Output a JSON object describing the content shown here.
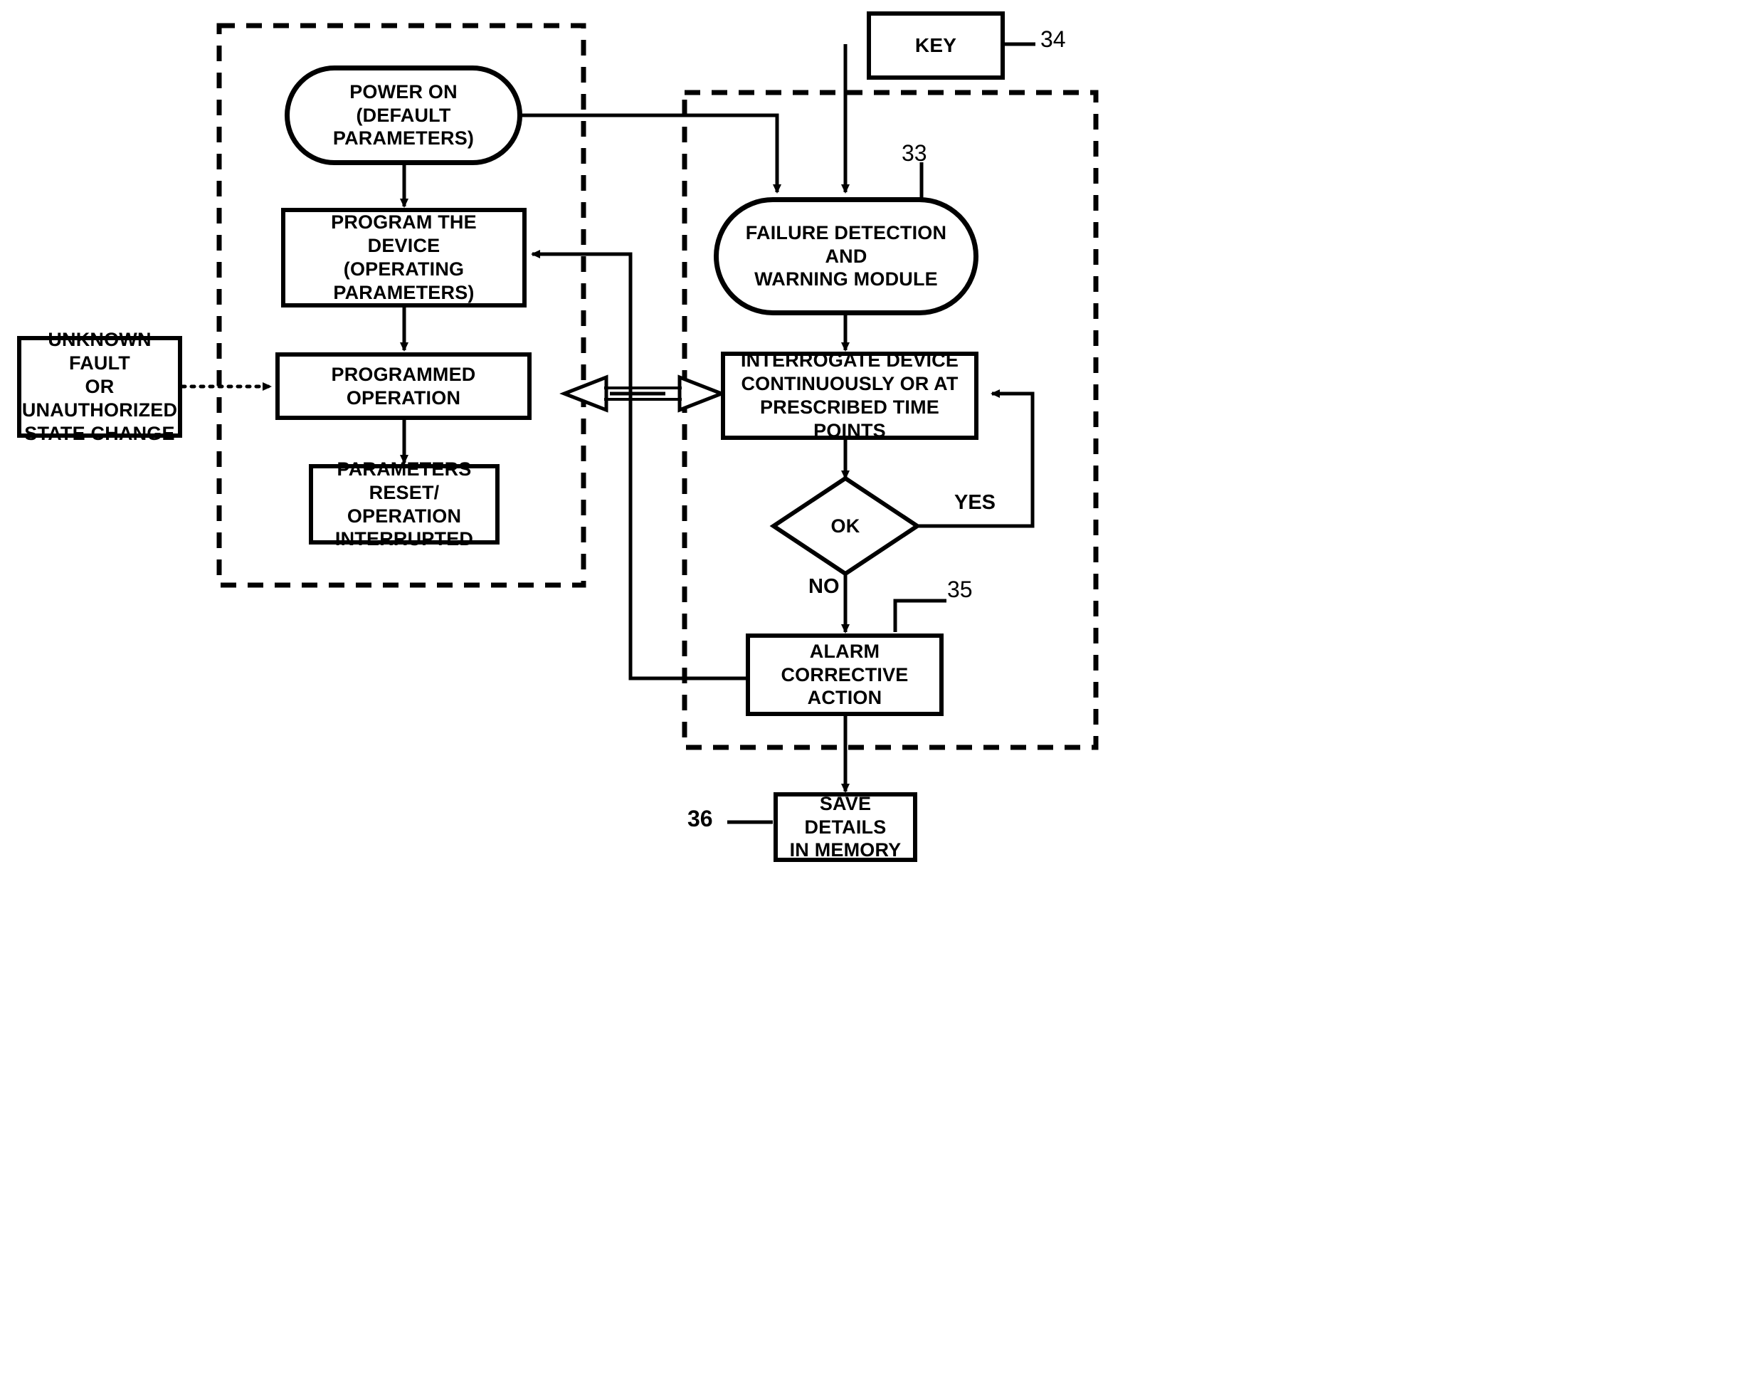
{
  "figure": {
    "type": "patent-flowchart",
    "background": "#ffffff",
    "stroke": "#000000"
  },
  "panels": [
    {
      "id": "device-panel",
      "style": "dashed-border",
      "label": ""
    },
    {
      "id": "module-panel",
      "style": "dashed-border",
      "label": ""
    }
  ],
  "nodes": {
    "power_on": {
      "label": "POWER ON\n(DEFAULT PARAMETERS)",
      "shape": "stadium"
    },
    "program_device": {
      "label": "PROGRAM THE DEVICE\n(OPERATING PARAMETERS)",
      "shape": "rect"
    },
    "programmed_op": {
      "label": "PROGRAMMED OPERATION",
      "shape": "rect"
    },
    "params_reset": {
      "label": "PARAMETERS RESET/\nOPERATION\nINTERRUPTED",
      "shape": "rect"
    },
    "unknown_fault": {
      "label": "UNKNOWN FAULT\nOR UNAUTHORIZED\nSTATE CHANGE",
      "shape": "rect"
    },
    "key": {
      "label": "KEY",
      "shape": "rect"
    },
    "failure_module": {
      "label": "FAILURE DETECTION AND\nWARNING MODULE",
      "shape": "stadium"
    },
    "interrogate": {
      "label": "INTERROGATE DEVICE\nCONTINUOUSLY OR AT\nPRESCRIBED TIME POINTS",
      "shape": "rect"
    },
    "decision_ok": {
      "label": "OK",
      "shape": "diamond"
    },
    "alarm": {
      "label": "ALARM\nCORRECTIVE ACTION",
      "shape": "rect"
    },
    "save_details": {
      "label": "SAVE DETAILS\nIN MEMORY",
      "shape": "rect"
    }
  },
  "edge_labels": {
    "yes": "YES",
    "no": "NO"
  },
  "reference_numerals": {
    "key_ref": "34",
    "module_ref": "33",
    "alarm_ref": "35",
    "save_ref": "36"
  }
}
